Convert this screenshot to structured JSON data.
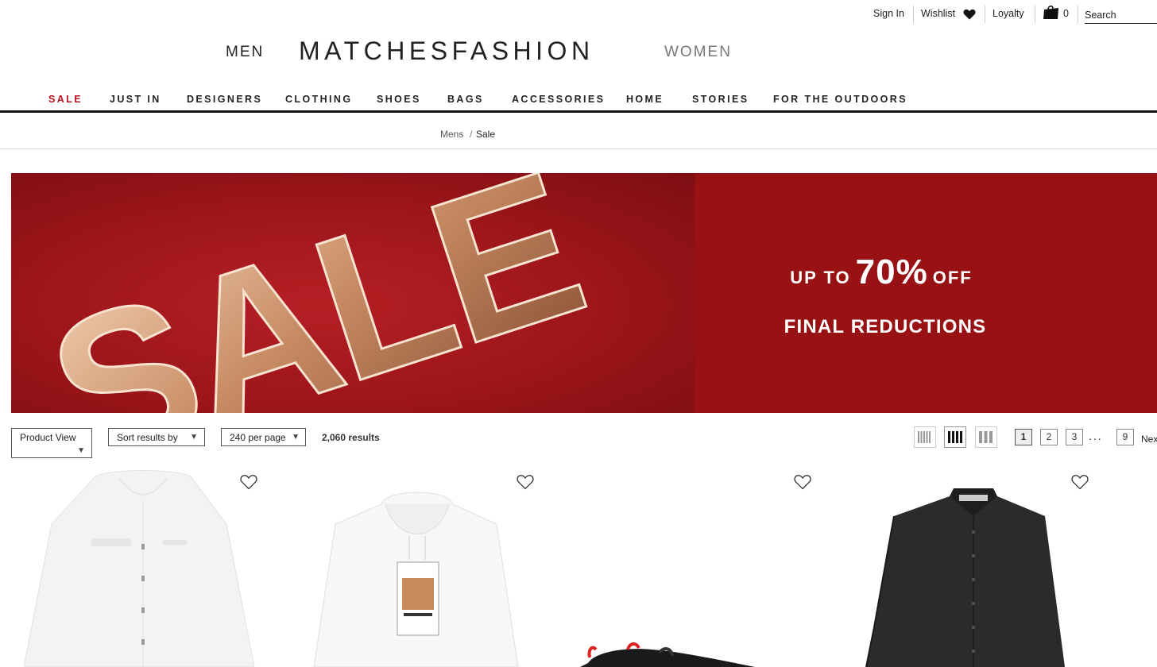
{
  "utility": {
    "sign_in": "Sign In",
    "wishlist": "Wishlist",
    "loyalty": "Loyalty",
    "bag_count": "0",
    "search_placeholder": "Search"
  },
  "header": {
    "men": "MEN",
    "logo": "MATCHESFASHION",
    "women": "WOMEN"
  },
  "nav": {
    "items": [
      "SALE",
      "JUST IN",
      "DESIGNERS",
      "CLOTHING",
      "SHOES",
      "BAGS",
      "ACCESSORIES",
      "HOME",
      "STORIES",
      "FOR THE OUTDOORS"
    ],
    "active_color": "#c0121f"
  },
  "breadcrumb": {
    "parent": "Mens",
    "separator": "/",
    "current": "Sale"
  },
  "banner": {
    "word": "SALE",
    "up_to": "UP TO",
    "percent": "70%",
    "off": "OFF",
    "line2": "FINAL REDUCTIONS",
    "bg_color": "#981214"
  },
  "controls": {
    "product_view": "Product View",
    "sort": "Sort results by",
    "per_page": "240 per page",
    "results": "2,060 results",
    "pages": [
      "1",
      "2",
      "3",
      "9"
    ],
    "current_page": "1",
    "ellipsis": "...",
    "next": "Next"
  },
  "products": [
    {
      "icon": "white-raincoat-image"
    },
    {
      "icon": "white-hoodie-image"
    },
    {
      "icon": "black-sneaker-image"
    },
    {
      "icon": "black-shirt-image"
    }
  ]
}
